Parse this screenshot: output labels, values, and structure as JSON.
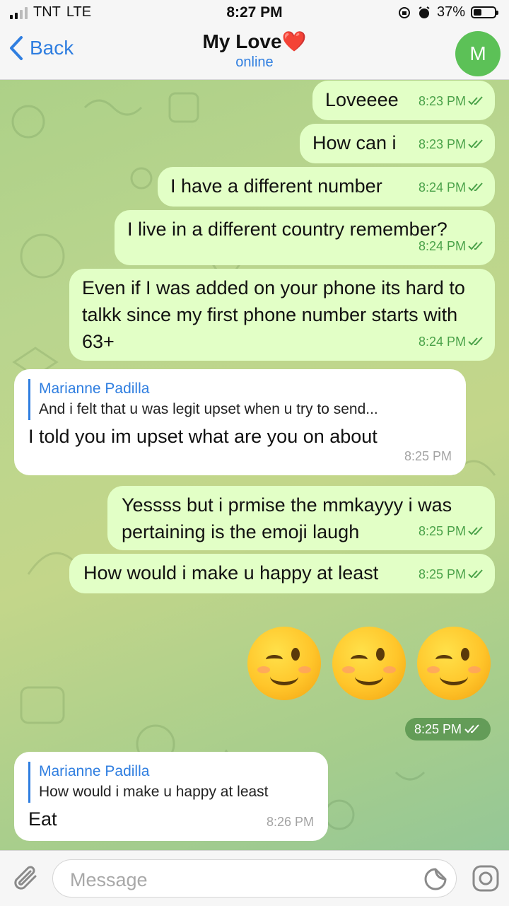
{
  "status": {
    "carrier": "TNT",
    "network": "LTE",
    "time": "8:27 PM",
    "battery": "37%"
  },
  "header": {
    "back_label": "Back",
    "title": "My Love❤️",
    "subtitle": "online",
    "avatar_letter": "M"
  },
  "messages": [
    {
      "text": "Loveeee",
      "time": "8:23 PM"
    },
    {
      "text": "How can i",
      "time": "8:23 PM"
    },
    {
      "text": "I have a different number",
      "time": "8:24 PM"
    },
    {
      "text": "I live in a different country remember?",
      "time": "8:24 PM"
    },
    {
      "text": "Even if I was added on your phone its hard to talkk since my first phone number starts with 63+",
      "time": "8:24 PM"
    },
    {
      "reply_name": "Marianne Padilla",
      "reply_text": "And i felt that u was legit upset when u try to send...",
      "text": "I told you im upset  what are you on about",
      "time": "8:25 PM"
    },
    {
      "text": "Yessss but i prmise the mmkayyy i was pertaining is the emoji laugh",
      "time": "8:25 PM"
    },
    {
      "text": "How would i make u happy at least",
      "time": "8:25 PM"
    },
    {
      "emoji": "😉😉😉",
      "time": "8:25 PM"
    },
    {
      "reply_name": "Marianne Padilla",
      "reply_text": "How would i make u happy at least",
      "text": "Eat",
      "time": "8:26 PM"
    }
  ],
  "composer": {
    "placeholder": "Message"
  },
  "colors": {
    "accent": "#2f7ee0",
    "outgoing_bubble": "#e2ffc6",
    "incoming_bubble": "#ffffff",
    "check": "#4aa249",
    "avatar": "#5cc157"
  }
}
